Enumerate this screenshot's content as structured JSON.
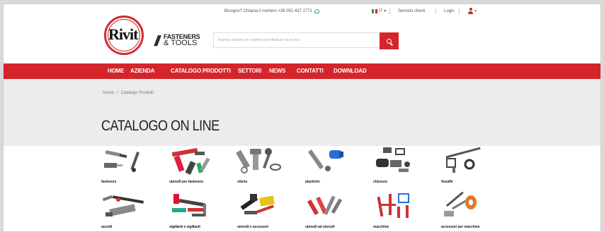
{
  "topbar": {
    "phone": "Bisogno? Chiama il numero +39 051 437 1771",
    "lang": "IT",
    "service": "Servizio clienti",
    "login": "Login"
  },
  "brand": {
    "name": "Rivit",
    "tagline_1": "FASTENERS",
    "tagline_2": "& TOOLS"
  },
  "search": {
    "placeholder": "Inserisci almeno tre caratteri per effettuare la ricerca"
  },
  "nav": [
    "HOME",
    "AZIENDA",
    "CATALOGO PRODOTTI",
    "SETTORI",
    "NEWS",
    "CONTATTI",
    "DOWNLOAD"
  ],
  "breadcrumb": [
    "Home",
    "Catalogo Prodotti"
  ],
  "page_title": "CATALOGO ON LINE",
  "products": [
    {
      "label": "fasteners",
      "icon": "fasteners-icon"
    },
    {
      "label": "utensili per fasteners",
      "icon": "riveting-tools-icon"
    },
    {
      "label": "viteria",
      "icon": "screws-icon"
    },
    {
      "label": "plastiche",
      "icon": "plastics-icon"
    },
    {
      "label": "chiusure",
      "icon": "latches-icon"
    },
    {
      "label": "fissaffe",
      "icon": "fixing-icon"
    },
    {
      "label": "ancolli",
      "icon": "anchors-icon"
    },
    {
      "label": "sigillanti e sigillanti",
      "icon": "sealants-icon"
    },
    {
      "label": "utensili e accessori",
      "icon": "hand-tools-icon"
    },
    {
      "label": "utensili ad utensili",
      "icon": "tool-set-icon"
    },
    {
      "label": "macchine",
      "icon": "machines-icon"
    },
    {
      "label": "accessori per macchine",
      "icon": "machine-accessories-icon"
    }
  ],
  "colors": {
    "brand_red": "#d4252b",
    "band": "#ececec",
    "accent_teal": "#2aa7a0"
  }
}
